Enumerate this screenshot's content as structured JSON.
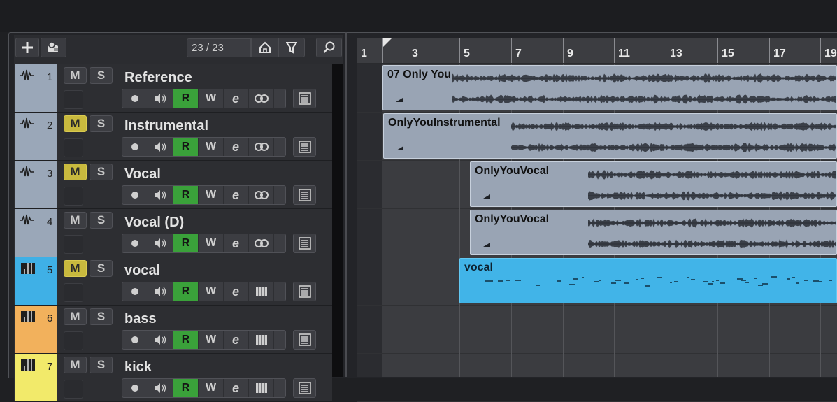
{
  "toolbar": {
    "add_track_icon": "plus-icon",
    "add_from_template_icon": "stack-add-icon",
    "track_counter": "23 / 23",
    "visibility_icon": "house-icon",
    "filter_icon": "funnel-icon",
    "search_icon": "search-icon"
  },
  "tracks": [
    {
      "number": "1",
      "name": "Reference",
      "type": "audio",
      "color": "#9aa7b8",
      "mute_label": "M",
      "solo_label": "S",
      "muted": false,
      "monitor_icon": "edit-icon",
      "extra_icon": "link-icon"
    },
    {
      "number": "2",
      "name": "Instrumental",
      "type": "audio",
      "color": "#9aa7b8",
      "mute_label": "M",
      "solo_label": "S",
      "muted": true,
      "monitor_icon": "edit-icon",
      "extra_icon": "link-icon"
    },
    {
      "number": "3",
      "name": "Vocal",
      "type": "audio",
      "color": "#9aa7b8",
      "mute_label": "M",
      "solo_label": "S",
      "muted": true,
      "monitor_icon": "edit-icon",
      "extra_icon": "link-icon"
    },
    {
      "number": "4",
      "name": "Vocal (D)",
      "type": "audio",
      "color": "#9aa7b8",
      "mute_label": "M",
      "solo_label": "S",
      "muted": false,
      "monitor_icon": "edit-icon",
      "extra_icon": "link-icon"
    },
    {
      "number": "5",
      "name": "vocal",
      "type": "instrument",
      "color": "#3fb0e6",
      "mute_label": "M",
      "solo_label": "S",
      "muted": true,
      "monitor_icon": "edit-icon",
      "extra_icon": "piano-icon"
    },
    {
      "number": "6",
      "name": "bass",
      "type": "instrument",
      "color": "#f2b15c",
      "mute_label": "M",
      "solo_label": "S",
      "muted": false,
      "monitor_icon": "edit-icon",
      "extra_icon": "piano-icon"
    },
    {
      "number": "7",
      "name": "kick",
      "type": "instrument",
      "color": "#f2ea6a",
      "mute_label": "M",
      "solo_label": "S",
      "muted": false,
      "monitor_icon": "edit-icon",
      "extra_icon": "piano-icon"
    }
  ],
  "track_buttons": {
    "read_label": "R",
    "write_label": "W"
  },
  "ruler": {
    "labels": [
      "1",
      "3",
      "5",
      "7",
      "9",
      "11",
      "13",
      "15",
      "17",
      "19"
    ]
  },
  "clips": [
    {
      "name": "07 Only You",
      "track": 1,
      "kind": "audio"
    },
    {
      "name": "OnlyYouInstrumental",
      "track": 2,
      "kind": "audio"
    },
    {
      "name": "OnlyYouVocal",
      "track": 3,
      "kind": "audio"
    },
    {
      "name": "OnlyYouVocal",
      "track": 4,
      "kind": "audio"
    },
    {
      "name": "vocal",
      "track": 5,
      "kind": "midi"
    }
  ],
  "colors": {
    "read_active": "#3aa13a",
    "mute_active": "#c8b93e",
    "audio_clip": "#99a4b4",
    "midi_clip": "#41b4e8"
  }
}
